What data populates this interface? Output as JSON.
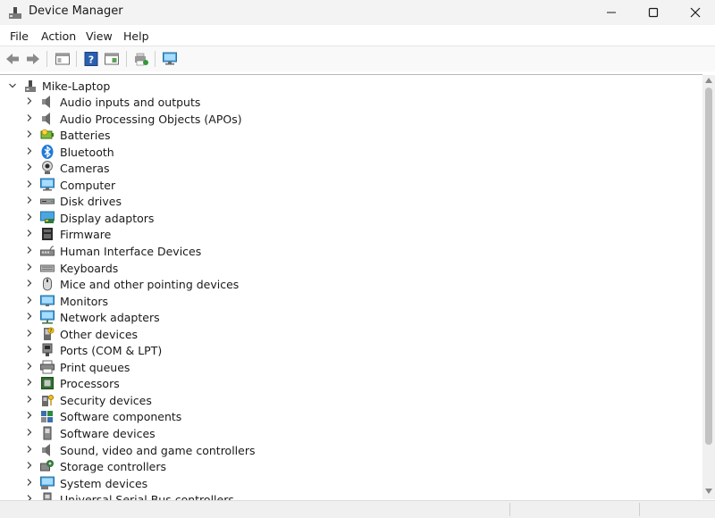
{
  "window": {
    "title": "Device Manager"
  },
  "menu": [
    "File",
    "Action",
    "View",
    "Help"
  ],
  "tree": {
    "root": "Mike-Laptop",
    "items": [
      {
        "label": "Audio inputs and outputs",
        "icon": "speaker-icon"
      },
      {
        "label": "Audio Processing Objects (APOs)",
        "icon": "speaker-icon"
      },
      {
        "label": "Batteries",
        "icon": "battery-icon"
      },
      {
        "label": "Bluetooth",
        "icon": "bluetooth-icon"
      },
      {
        "label": "Cameras",
        "icon": "camera-icon"
      },
      {
        "label": "Computer",
        "icon": "computer-icon"
      },
      {
        "label": "Disk drives",
        "icon": "disk-drive-icon"
      },
      {
        "label": "Display adaptors",
        "icon": "display-adapter-icon"
      },
      {
        "label": "Firmware",
        "icon": "firmware-icon"
      },
      {
        "label": "Human Interface Devices",
        "icon": "hid-icon"
      },
      {
        "label": "Keyboards",
        "icon": "keyboard-icon"
      },
      {
        "label": "Mice and other pointing devices",
        "icon": "mouse-icon"
      },
      {
        "label": "Monitors",
        "icon": "monitor-icon"
      },
      {
        "label": "Network adapters",
        "icon": "network-icon"
      },
      {
        "label": "Other devices",
        "icon": "other-device-icon"
      },
      {
        "label": "Ports (COM & LPT)",
        "icon": "port-icon"
      },
      {
        "label": "Print queues",
        "icon": "printer-icon"
      },
      {
        "label": "Processors",
        "icon": "processor-icon"
      },
      {
        "label": "Security devices",
        "icon": "security-icon"
      },
      {
        "label": "Software components",
        "icon": "software-component-icon"
      },
      {
        "label": "Software devices",
        "icon": "software-device-icon"
      },
      {
        "label": "Sound, video and game controllers",
        "icon": "speaker-icon"
      },
      {
        "label": "Storage controllers",
        "icon": "storage-icon"
      },
      {
        "label": "System devices",
        "icon": "system-icon"
      },
      {
        "label": "Universal Serial Bus controllers",
        "icon": "usb-icon"
      }
    ]
  }
}
